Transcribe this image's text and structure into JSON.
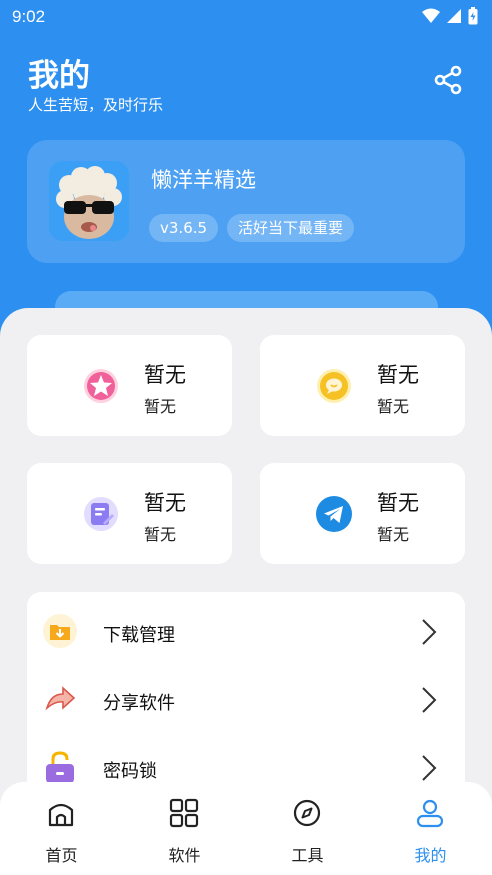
{
  "status_bar": {
    "time": "9:02"
  },
  "header": {
    "title": "我的",
    "subtitle": "人生苦短，及时行乐"
  },
  "profile": {
    "app_name": "懒洋羊精选",
    "version": "v3.6.5",
    "slogan": "活好当下最重要"
  },
  "cards": [
    {
      "title": "暂无",
      "subtitle": "暂无",
      "icon": "pink-star-icon",
      "color": "#f0609a"
    },
    {
      "title": "暂无",
      "subtitle": "暂无",
      "icon": "yellow-chat-icon",
      "color": "#f5c125"
    },
    {
      "title": "暂无",
      "subtitle": "暂无",
      "icon": "purple-note-icon",
      "color": "#8c7cf2"
    },
    {
      "title": "暂无",
      "subtitle": "暂无",
      "icon": "telegram-icon",
      "color": "#1e8be3"
    }
  ],
  "menu": [
    {
      "label": "下载管理",
      "icon": "download-folder-icon"
    },
    {
      "label": "分享软件",
      "icon": "share-arrow-icon"
    },
    {
      "label": "密码锁",
      "icon": "lock-icon"
    }
  ],
  "tabs": [
    {
      "label": "首页",
      "icon": "home-icon"
    },
    {
      "label": "软件",
      "icon": "grid-icon"
    },
    {
      "label": "工具",
      "icon": "compass-icon"
    },
    {
      "label": "我的",
      "icon": "user-icon",
      "active": true
    }
  ],
  "colors": {
    "primary": "#2d8ff0",
    "background": "#f0f0f2"
  }
}
